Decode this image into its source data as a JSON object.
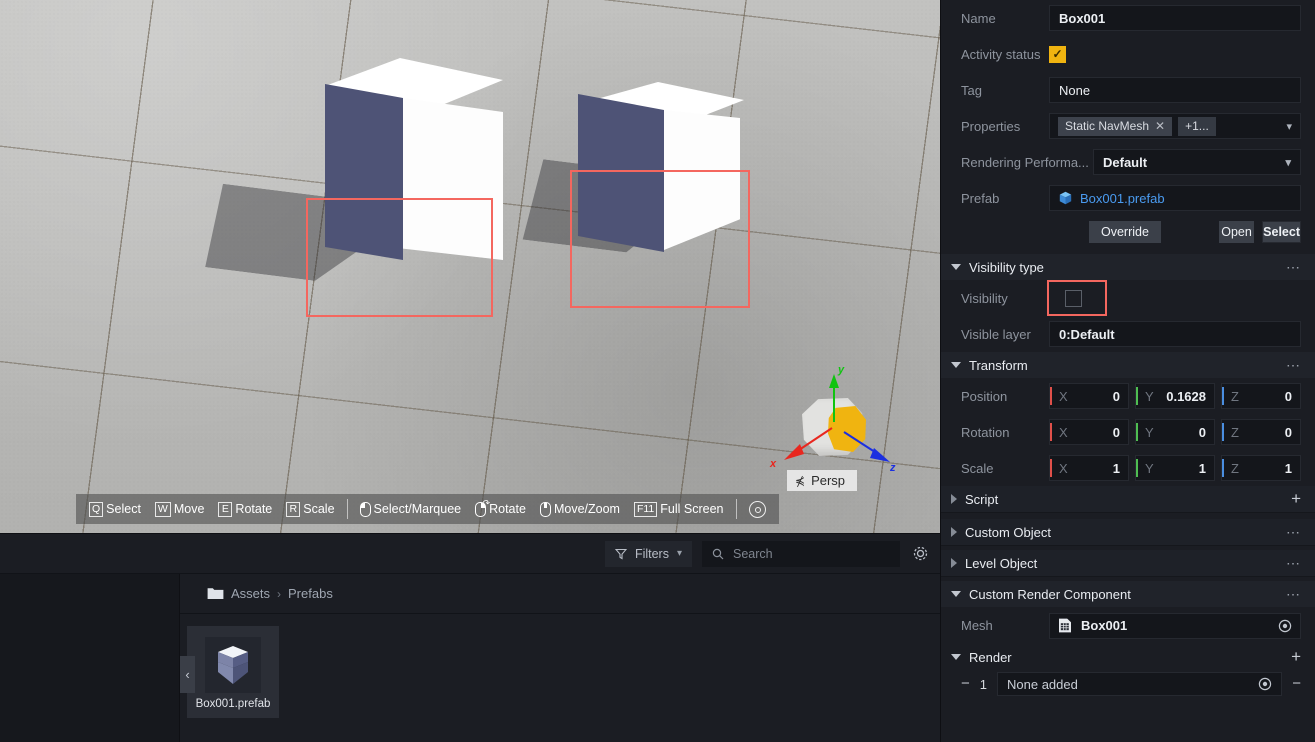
{
  "viewport": {
    "toolbar": {
      "items": [
        {
          "key": "Q",
          "label": "Select",
          "icon": "keycap"
        },
        {
          "key": "W",
          "label": "Move",
          "icon": "keycap"
        },
        {
          "key": "E",
          "label": "Rotate",
          "icon": "keycap"
        },
        {
          "key": "R",
          "label": "Scale",
          "icon": "keycap"
        },
        {
          "key": "",
          "label": "Select/Marquee",
          "icon": "mouse-left-icon"
        },
        {
          "key": "",
          "label": "Rotate",
          "icon": "mouse-right-icon"
        },
        {
          "key": "",
          "label": "Move/Zoom",
          "icon": "mouse-middle-icon"
        },
        {
          "key": "F11",
          "label": "Full Screen",
          "icon": "keycap"
        }
      ],
      "settings_icon": "viewport-settings-icon"
    },
    "gizmo": {
      "axis_x": "x",
      "axis_y": "y",
      "axis_z": "z",
      "projection_label": "Persp",
      "projection_icon": "perspective-icon",
      "colors": {
        "x": "#e8271f",
        "y": "#10c410",
        "z": "#1b2fe0",
        "highlight": "#f0b410"
      }
    },
    "selection": {
      "color": "#f4675f",
      "count": 2
    },
    "objects": [
      {
        "name": "Box001",
        "face_color": "#ffffff",
        "side_color": "#4e5376"
      },
      {
        "name": "Box001",
        "face_color": "#ffffff",
        "side_color": "#4e5376"
      }
    ]
  },
  "browser": {
    "filters_label": "Filters",
    "filters_icon": "funnel-icon",
    "filters_caret": "chevron-down-icon",
    "search_placeholder": "Search",
    "search_value": "",
    "search_icon": "search-icon",
    "settings_icon": "gear-icon",
    "breadcrumb": [
      "Assets",
      "Prefabs"
    ],
    "breadcrumb_sep": "›",
    "folder_icon": "folder-icon",
    "collapse_handle_icon": "chevron-left-icon",
    "assets": [
      {
        "label": "Box001.prefab",
        "icon": "prefab-icon",
        "selected": true
      }
    ]
  },
  "inspector": {
    "name_label": "Name",
    "name_value": "Box001",
    "activity_label": "Activity status",
    "activity_checked": true,
    "activity_color": "#f0b410",
    "tag_label": "Tag",
    "tag_value": "None",
    "properties_label": "Properties",
    "properties_chips": [
      "Static NavMesh",
      "+1..."
    ],
    "properties_caret": "chevron-down-icon",
    "rendering_label": "Rendering Performa...",
    "rendering_value": "Default",
    "rendering_caret": "chevron-down-icon",
    "prefab_label": "Prefab",
    "prefab_value": "Box001.prefab",
    "prefab_icon": "prefab-cube-icon",
    "buttons": {
      "override": "Override",
      "open": "Open",
      "select": "Select"
    },
    "visibility_section": {
      "title": "Visibility type",
      "expanded": true,
      "menu_icon": "ellipsis-icon",
      "visibility_label": "Visibility",
      "visibility_checked": false,
      "highlight_color": "#f4675f",
      "visible_layer_label": "Visible layer",
      "visible_layer_value": "0:Default"
    },
    "transform_section": {
      "title": "Transform",
      "expanded": true,
      "menu_icon": "ellipsis-icon",
      "rows": [
        {
          "label": "Position",
          "x": "0",
          "y": "0.1628",
          "z": "0"
        },
        {
          "label": "Rotation",
          "x": "0",
          "y": "0",
          "z": "0"
        },
        {
          "label": "Scale",
          "x": "1",
          "y": "1",
          "z": "1"
        }
      ],
      "axis_names": {
        "x": "X",
        "y": "Y",
        "z": "Z"
      },
      "axis_colors": {
        "x": "#e0504a",
        "y": "#4fbe52",
        "z": "#4a8ee0"
      }
    },
    "script_section": {
      "title": "Script",
      "expanded": false,
      "add_icon": "plus-icon"
    },
    "custom_object_section": {
      "title": "Custom Object",
      "expanded": false,
      "menu_icon": "ellipsis-icon"
    },
    "level_object_section": {
      "title": "Level Object",
      "expanded": false,
      "menu_icon": "ellipsis-icon"
    },
    "custom_render_section": {
      "title": "Custom Render Component",
      "expanded": true,
      "menu_icon": "ellipsis-icon",
      "mesh_label": "Mesh",
      "mesh_value": "Box001",
      "mesh_icon": "mesh-file-icon",
      "mesh_picker_icon": "target-icon"
    },
    "render_section": {
      "title": "Render",
      "expanded": true,
      "add_icon": "plus-icon",
      "items": [
        {
          "index": "1",
          "value": "None added",
          "remove_icon": "minus-icon",
          "picker_icon": "target-icon"
        }
      ]
    }
  }
}
